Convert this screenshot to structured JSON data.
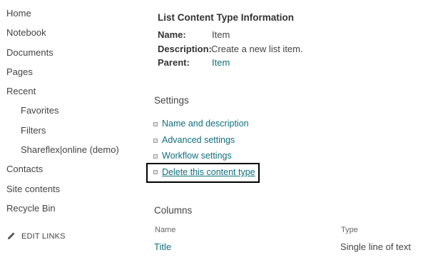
{
  "nav": {
    "items": [
      {
        "label": "Home"
      },
      {
        "label": "Notebook"
      },
      {
        "label": "Documents"
      },
      {
        "label": "Pages"
      },
      {
        "label": "Recent"
      }
    ],
    "recent_items": [
      {
        "label": "Favorites"
      },
      {
        "label": "Filters"
      },
      {
        "label": "Shareflex|online (demo)"
      }
    ],
    "bottom_items": [
      {
        "label": "Contacts"
      },
      {
        "label": "Site contents"
      },
      {
        "label": "Recycle Bin"
      }
    ],
    "edit_links_label": "EDIT LINKS",
    "edit_links_icon": "pencil-icon"
  },
  "info": {
    "title": "List Content Type Information",
    "name_label": "Name:",
    "name_value": "Item",
    "description_label": "Description:",
    "description_value": "Create a new list item.",
    "parent_label": "Parent:",
    "parent_value": "Item"
  },
  "settings": {
    "heading": "Settings",
    "links": [
      {
        "label": "Name and description"
      },
      {
        "label": "Advanced settings"
      },
      {
        "label": "Workflow settings"
      },
      {
        "label": "Delete this content type"
      }
    ]
  },
  "columns": {
    "heading": "Columns",
    "headers": {
      "name": "Name",
      "type": "Type"
    },
    "rows": [
      {
        "name": "Title",
        "type": "Single line of text"
      }
    ]
  },
  "colors": {
    "link": "#0f6f7c",
    "text": "#444444",
    "highlight_border": "#000000"
  }
}
